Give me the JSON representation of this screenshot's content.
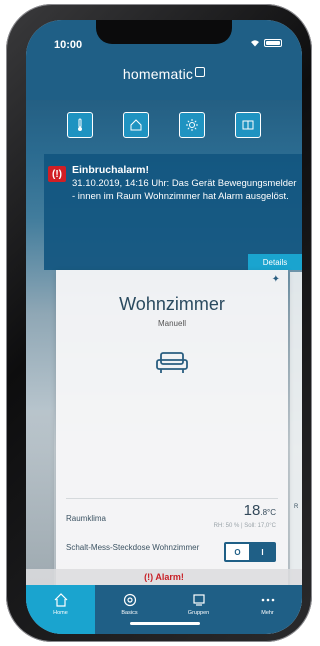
{
  "status": {
    "time": "10:00"
  },
  "app": {
    "title": "homematic"
  },
  "quick_actions": [
    {
      "icon": "thermometer-icon"
    },
    {
      "icon": "house-icon"
    },
    {
      "icon": "sun-icon"
    },
    {
      "icon": "shutter-icon"
    }
  ],
  "alarm": {
    "badge": "(!)",
    "title": "Einbruchalarm!",
    "text": "31.10.2019, 14:16 Uhr: Das Gerät Bewegungsmelder - innen im Raum Wohnzimmer hat Alarm ausgelöst.",
    "details_label": "Details"
  },
  "room": {
    "name": "Wohnzimmer",
    "mode": "Manuell",
    "climate_label": "Raumklima",
    "temperature": "18",
    "temperature_unit": ".8°C",
    "climate_detail": "RH: 50 % | Soll: 17,0°C",
    "switch_label": "Schalt-Mess-Steckdose Wohnzimmer",
    "toggle_off": "O",
    "toggle_on": "I"
  },
  "side_card": {
    "label": "R"
  },
  "alarm_bar": {
    "label": "(!) Alarm!"
  },
  "tabs": [
    {
      "label": "Home",
      "icon": "home-icon"
    },
    {
      "label": "Basics",
      "icon": "basics-icon"
    },
    {
      "label": "Gruppen",
      "icon": "groups-icon"
    },
    {
      "label": "Mehr",
      "icon": "more-icon"
    }
  ],
  "colors": {
    "primary": "#1f5f86",
    "accent": "#1aa4cf",
    "alarm": "#d11f25"
  }
}
